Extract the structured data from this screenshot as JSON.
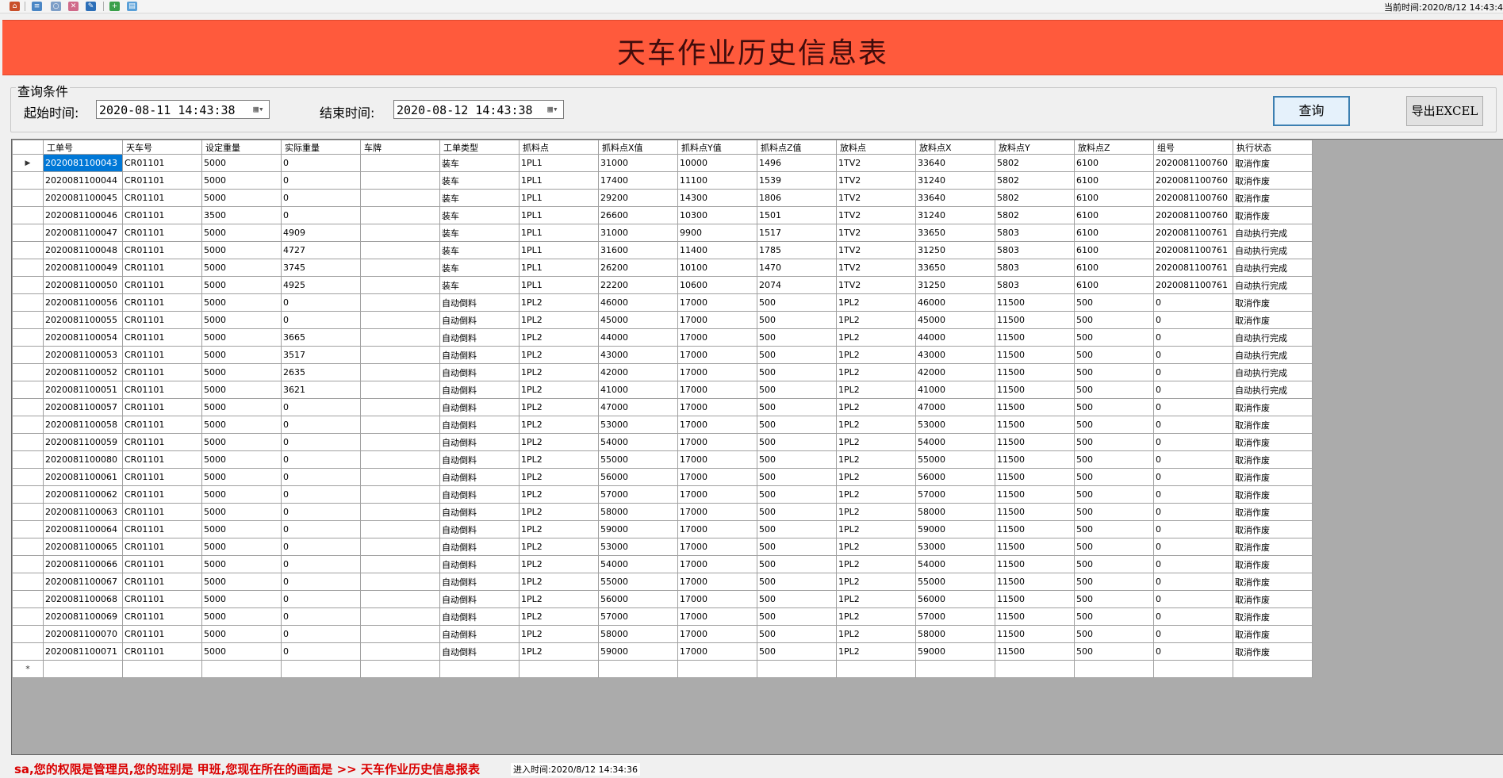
{
  "toolbar": {
    "icons": [
      "home-icon",
      "report-icon",
      "globe-icon",
      "tools-icon",
      "edit-icon",
      "add-icon",
      "book-icon"
    ],
    "clock": "当前时间:2020/8/12 14:43:4"
  },
  "title": "天车作业历史信息表",
  "query": {
    "legend": "查询条件",
    "start_label": "起始时间:",
    "start_value": "2020-08-11 14:43:38",
    "end_label": "结束时间:",
    "end_value": "2020-08-12 14:43:38",
    "query_button": "查询",
    "export_button": "导出EXCEL"
  },
  "grid": {
    "columns": [
      "工单号",
      "天车号",
      "设定重量",
      "实际重量",
      "车牌",
      "工单类型",
      "抓料点",
      "抓料点X值",
      "抓料点Y值",
      "抓料点Z值",
      "放料点",
      "放料点X",
      "放料点Y",
      "放料点Z",
      "组号",
      "执行状态"
    ],
    "rows": [
      [
        "2020081100043",
        "CR01101",
        "5000",
        "0",
        "",
        "装车",
        "1PL1",
        "31000",
        "10000",
        "1496",
        "1TV2",
        "33640",
        "5802",
        "6100",
        "2020081100760",
        "取消作废"
      ],
      [
        "2020081100044",
        "CR01101",
        "5000",
        "0",
        "",
        "装车",
        "1PL1",
        "17400",
        "11100",
        "1539",
        "1TV2",
        "31240",
        "5802",
        "6100",
        "2020081100760",
        "取消作废"
      ],
      [
        "2020081100045",
        "CR01101",
        "5000",
        "0",
        "",
        "装车",
        "1PL1",
        "29200",
        "14300",
        "1806",
        "1TV2",
        "33640",
        "5802",
        "6100",
        "2020081100760",
        "取消作废"
      ],
      [
        "2020081100046",
        "CR01101",
        "3500",
        "0",
        "",
        "装车",
        "1PL1",
        "26600",
        "10300",
        "1501",
        "1TV2",
        "31240",
        "5802",
        "6100",
        "2020081100760",
        "取消作废"
      ],
      [
        "2020081100047",
        "CR01101",
        "5000",
        "4909",
        "",
        "装车",
        "1PL1",
        "31000",
        "9900",
        "1517",
        "1TV2",
        "33650",
        "5803",
        "6100",
        "2020081100761",
        "自动执行完成"
      ],
      [
        "2020081100048",
        "CR01101",
        "5000",
        "4727",
        "",
        "装车",
        "1PL1",
        "31600",
        "11400",
        "1785",
        "1TV2",
        "31250",
        "5803",
        "6100",
        "2020081100761",
        "自动执行完成"
      ],
      [
        "2020081100049",
        "CR01101",
        "5000",
        "3745",
        "",
        "装车",
        "1PL1",
        "26200",
        "10100",
        "1470",
        "1TV2",
        "33650",
        "5803",
        "6100",
        "2020081100761",
        "自动执行完成"
      ],
      [
        "2020081100050",
        "CR01101",
        "5000",
        "4925",
        "",
        "装车",
        "1PL1",
        "22200",
        "10600",
        "2074",
        "1TV2",
        "31250",
        "5803",
        "6100",
        "2020081100761",
        "自动执行完成"
      ],
      [
        "2020081100056",
        "CR01101",
        "5000",
        "0",
        "",
        "自动倒料",
        "1PL2",
        "46000",
        "17000",
        "500",
        "1PL2",
        "46000",
        "11500",
        "500",
        "0",
        "取消作废"
      ],
      [
        "2020081100055",
        "CR01101",
        "5000",
        "0",
        "",
        "自动倒料",
        "1PL2",
        "45000",
        "17000",
        "500",
        "1PL2",
        "45000",
        "11500",
        "500",
        "0",
        "取消作废"
      ],
      [
        "2020081100054",
        "CR01101",
        "5000",
        "3665",
        "",
        "自动倒料",
        "1PL2",
        "44000",
        "17000",
        "500",
        "1PL2",
        "44000",
        "11500",
        "500",
        "0",
        "自动执行完成"
      ],
      [
        "2020081100053",
        "CR01101",
        "5000",
        "3517",
        "",
        "自动倒料",
        "1PL2",
        "43000",
        "17000",
        "500",
        "1PL2",
        "43000",
        "11500",
        "500",
        "0",
        "自动执行完成"
      ],
      [
        "2020081100052",
        "CR01101",
        "5000",
        "2635",
        "",
        "自动倒料",
        "1PL2",
        "42000",
        "17000",
        "500",
        "1PL2",
        "42000",
        "11500",
        "500",
        "0",
        "自动执行完成"
      ],
      [
        "2020081100051",
        "CR01101",
        "5000",
        "3621",
        "",
        "自动倒料",
        "1PL2",
        "41000",
        "17000",
        "500",
        "1PL2",
        "41000",
        "11500",
        "500",
        "0",
        "自动执行完成"
      ],
      [
        "2020081100057",
        "CR01101",
        "5000",
        "0",
        "",
        "自动倒料",
        "1PL2",
        "47000",
        "17000",
        "500",
        "1PL2",
        "47000",
        "11500",
        "500",
        "0",
        "取消作废"
      ],
      [
        "2020081100058",
        "CR01101",
        "5000",
        "0",
        "",
        "自动倒料",
        "1PL2",
        "53000",
        "17000",
        "500",
        "1PL2",
        "53000",
        "11500",
        "500",
        "0",
        "取消作废"
      ],
      [
        "2020081100059",
        "CR01101",
        "5000",
        "0",
        "",
        "自动倒料",
        "1PL2",
        "54000",
        "17000",
        "500",
        "1PL2",
        "54000",
        "11500",
        "500",
        "0",
        "取消作废"
      ],
      [
        "2020081100080",
        "CR01101",
        "5000",
        "0",
        "",
        "自动倒料",
        "1PL2",
        "55000",
        "17000",
        "500",
        "1PL2",
        "55000",
        "11500",
        "500",
        "0",
        "取消作废"
      ],
      [
        "2020081100061",
        "CR01101",
        "5000",
        "0",
        "",
        "自动倒料",
        "1PL2",
        "56000",
        "17000",
        "500",
        "1PL2",
        "56000",
        "11500",
        "500",
        "0",
        "取消作废"
      ],
      [
        "2020081100062",
        "CR01101",
        "5000",
        "0",
        "",
        "自动倒料",
        "1PL2",
        "57000",
        "17000",
        "500",
        "1PL2",
        "57000",
        "11500",
        "500",
        "0",
        "取消作废"
      ],
      [
        "2020081100063",
        "CR01101",
        "5000",
        "0",
        "",
        "自动倒料",
        "1PL2",
        "58000",
        "17000",
        "500",
        "1PL2",
        "58000",
        "11500",
        "500",
        "0",
        "取消作废"
      ],
      [
        "2020081100064",
        "CR01101",
        "5000",
        "0",
        "",
        "自动倒料",
        "1PL2",
        "59000",
        "17000",
        "500",
        "1PL2",
        "59000",
        "11500",
        "500",
        "0",
        "取消作废"
      ],
      [
        "2020081100065",
        "CR01101",
        "5000",
        "0",
        "",
        "自动倒料",
        "1PL2",
        "53000",
        "17000",
        "500",
        "1PL2",
        "53000",
        "11500",
        "500",
        "0",
        "取消作废"
      ],
      [
        "2020081100066",
        "CR01101",
        "5000",
        "0",
        "",
        "自动倒料",
        "1PL2",
        "54000",
        "17000",
        "500",
        "1PL2",
        "54000",
        "11500",
        "500",
        "0",
        "取消作废"
      ],
      [
        "2020081100067",
        "CR01101",
        "5000",
        "0",
        "",
        "自动倒料",
        "1PL2",
        "55000",
        "17000",
        "500",
        "1PL2",
        "55000",
        "11500",
        "500",
        "0",
        "取消作废"
      ],
      [
        "2020081100068",
        "CR01101",
        "5000",
        "0",
        "",
        "自动倒料",
        "1PL2",
        "56000",
        "17000",
        "500",
        "1PL2",
        "56000",
        "11500",
        "500",
        "0",
        "取消作废"
      ],
      [
        "2020081100069",
        "CR01101",
        "5000",
        "0",
        "",
        "自动倒料",
        "1PL2",
        "57000",
        "17000",
        "500",
        "1PL2",
        "57000",
        "11500",
        "500",
        "0",
        "取消作废"
      ],
      [
        "2020081100070",
        "CR01101",
        "5000",
        "0",
        "",
        "自动倒料",
        "1PL2",
        "58000",
        "17000",
        "500",
        "1PL2",
        "58000",
        "11500",
        "500",
        "0",
        "取消作废"
      ],
      [
        "2020081100071",
        "CR01101",
        "5000",
        "0",
        "",
        "自动倒料",
        "1PL2",
        "59000",
        "17000",
        "500",
        "1PL2",
        "59000",
        "11500",
        "500",
        "0",
        "取消作废"
      ]
    ],
    "current_row_marker": "▶",
    "new_row_marker": "*"
  },
  "status": {
    "message": "sa,您的权限是管理员,您的班别是 甲班,您现在所在的画面是 >>  天车作业历史信息报表",
    "enter_time": "进入时间:2020/8/12 14:34:36"
  },
  "colors": {
    "banner": "#ff5a3c",
    "title_text": "#400c0c",
    "selection": "#0078d7",
    "status_text": "#d90000"
  }
}
